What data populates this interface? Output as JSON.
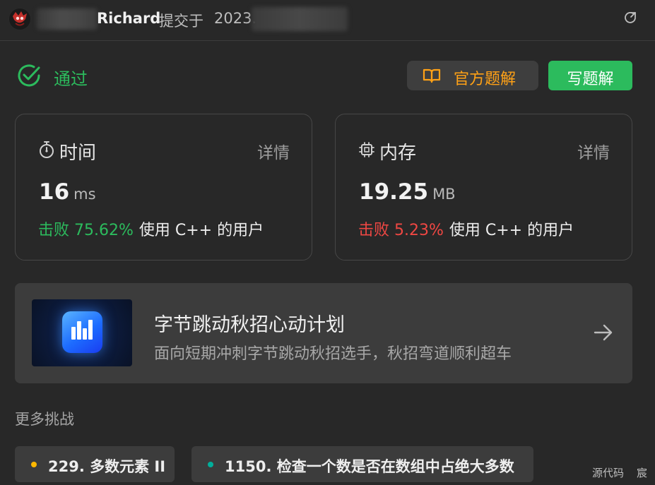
{
  "header": {
    "author": "Richard",
    "submitted_text": "提交于",
    "date_prefix": "2023."
  },
  "status": {
    "label": "通过",
    "color": "#2cbb5d"
  },
  "buttons": {
    "official_solution": "官方题解",
    "write_solution": "写题解"
  },
  "stats": {
    "time": {
      "title": "时间",
      "detail": "详情",
      "value": "16",
      "unit": "ms",
      "beat_label": "击败 75.62%",
      "beat_rest": "使用 C++ 的用户",
      "beat_color": "#2cbb5d",
      "icon": "stopwatch-icon"
    },
    "memory": {
      "title": "内存",
      "detail": "详情",
      "value": "19.25",
      "unit": "MB",
      "beat_label": "击败 5.23%",
      "beat_rest": "使用 C++ 的用户",
      "beat_color": "#ef4743",
      "icon": "chip-icon"
    }
  },
  "banner": {
    "title": "字节跳动秋招心动计划",
    "description": "面向短期冲刺字节跳动秋招选手，秋招弯道顺利超车"
  },
  "more": {
    "title": "更多挑战",
    "items": [
      {
        "label": "229. 多数元素 II",
        "dot_color": "#ffb800"
      },
      {
        "label": "1150. 检查一个数是否在数组中占绝大多数",
        "dot_color": "#00af9b"
      }
    ]
  },
  "footer": {
    "source_code": "源代码",
    "extra": "宸"
  },
  "colors": {
    "background": "#282828",
    "accent_green": "#2cbb5d",
    "accent_orange": "#ffa116",
    "danger": "#ef4743"
  }
}
